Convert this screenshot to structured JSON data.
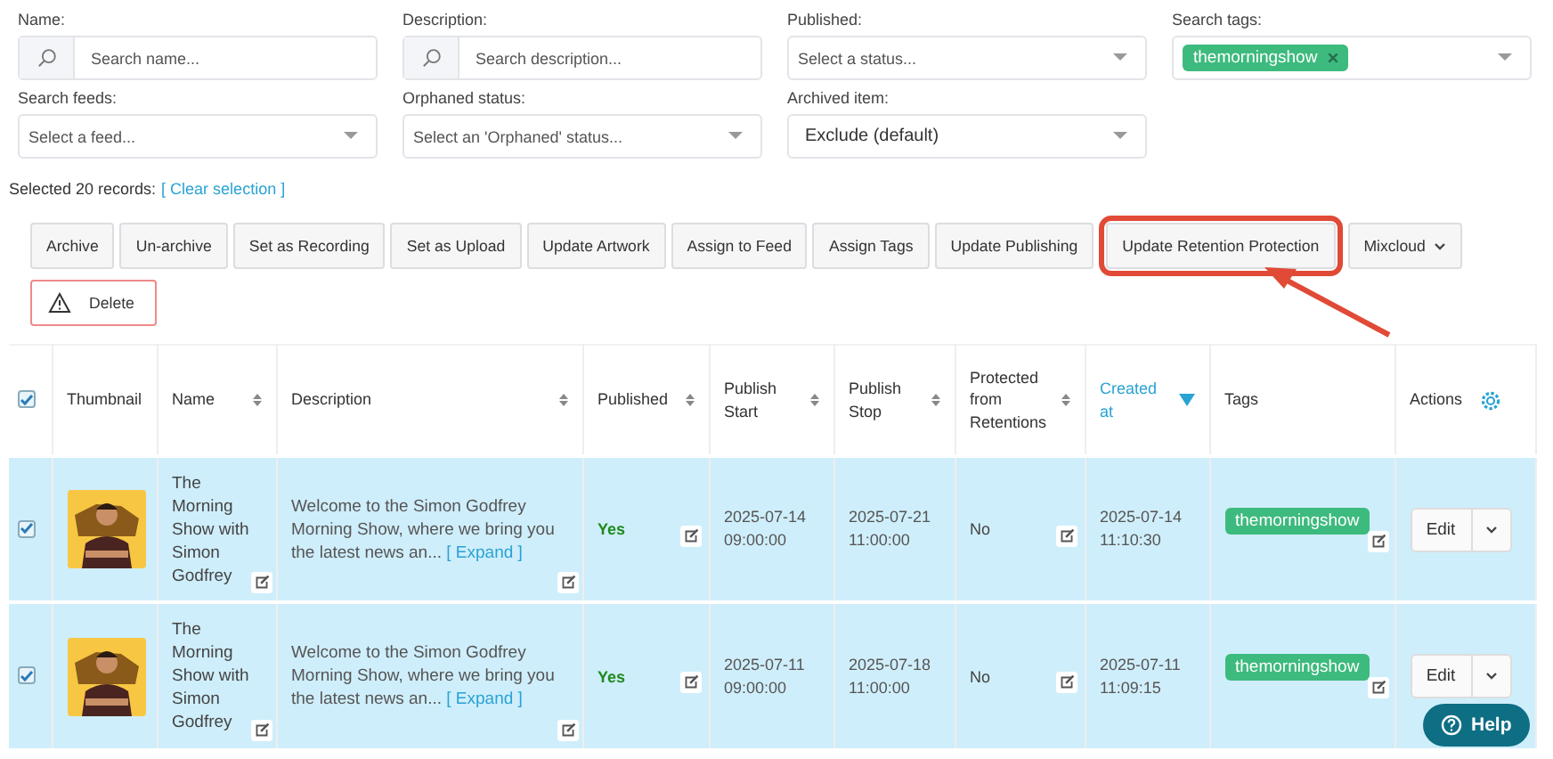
{
  "filters": [
    {
      "label": "Name:",
      "kind": "search",
      "placeholder": "Search name..."
    },
    {
      "label": "Description:",
      "kind": "search",
      "placeholder": "Search description..."
    },
    {
      "label": "Published:",
      "kind": "select",
      "placeholder": "Select a status..."
    },
    {
      "label": "Search tags:",
      "kind": "tags",
      "tags": [
        "themorningshow"
      ]
    },
    {
      "label": "Search feeds:",
      "kind": "select",
      "placeholder": "Select a feed..."
    },
    {
      "label": "Orphaned status:",
      "kind": "select",
      "placeholder": "Select an 'Orphaned' status..."
    },
    {
      "label": "Archived item:",
      "kind": "select",
      "value": "Exclude (default)"
    }
  ],
  "selection": {
    "text": "Selected 20 records:",
    "link": "[ Clear selection ]"
  },
  "actions": [
    {
      "label": "Archive",
      "kind": "plain",
      "highlighted": false
    },
    {
      "label": "Un-archive",
      "kind": "plain",
      "highlighted": false
    },
    {
      "label": "Set as Recording",
      "kind": "plain",
      "highlighted": false
    },
    {
      "label": "Set as Upload",
      "kind": "plain",
      "highlighted": false
    },
    {
      "label": "Update Artwork",
      "kind": "plain",
      "highlighted": false
    },
    {
      "label": "Assign to Feed",
      "kind": "plain",
      "highlighted": false
    },
    {
      "label": "Assign Tags",
      "kind": "plain",
      "highlighted": false
    },
    {
      "label": "Update Publishing",
      "kind": "plain",
      "highlighted": false
    },
    {
      "label": "Update Retention Protection",
      "kind": "plain",
      "highlighted": true
    },
    {
      "label": "Mixcloud",
      "kind": "dropdown",
      "highlighted": false
    },
    {
      "label": "Delete",
      "kind": "danger",
      "highlighted": false
    }
  ],
  "table": {
    "select_all": {
      "checked": true
    },
    "columns": [
      {
        "label": "Thumbnail",
        "sortable": false,
        "sorted": false
      },
      {
        "label": "Name",
        "sortable": true,
        "sorted": false
      },
      {
        "label": "Description",
        "sortable": true,
        "sorted": false
      },
      {
        "label": "Published",
        "sortable": true,
        "sorted": false
      },
      {
        "label": "Publish Start",
        "sortable": true,
        "sorted": false
      },
      {
        "label": "Publish Stop",
        "sortable": true,
        "sorted": false
      },
      {
        "label": "Protected from Retentions",
        "sortable": true,
        "sorted": false
      },
      {
        "label": "Created at",
        "sortable": true,
        "sorted": true
      },
      {
        "label": "Tags",
        "sortable": false,
        "sorted": false
      },
      {
        "label": "Actions",
        "sortable": false,
        "sorted": false
      }
    ],
    "rows": [
      {
        "selected": true,
        "thumbnail": {
          "kind": "picture"
        },
        "name": "The Morning Show with Simon Godfrey",
        "description": "Welcome to the Simon Godfrey Morning Show, where we bring you the latest news an...",
        "expand": "[ Expand ]",
        "published": "Yes",
        "publish_start": "2025-07-14 09:00:00",
        "publish_stop": "2025-07-21 11:00:00",
        "protected": "No",
        "created_at": "2025-07-14 11:10:30",
        "tags": [
          "themorningshow"
        ],
        "action": "Edit"
      },
      {
        "selected": true,
        "thumbnail": {
          "kind": "picture"
        },
        "name": "The Morning Show with Simon Godfrey",
        "description": "Welcome to the Simon Godfrey Morning Show, where we bring you the latest news an...",
        "expand": "[ Expand ]",
        "published": "Yes",
        "publish_start": "2025-07-11 09:00:00",
        "publish_stop": "2025-07-18 11:00:00",
        "protected": "No",
        "created_at": "2025-07-11 11:09:15",
        "tags": [
          "themorningshow"
        ],
        "action": "Edit"
      }
    ]
  },
  "help": {
    "label": "Help"
  }
}
